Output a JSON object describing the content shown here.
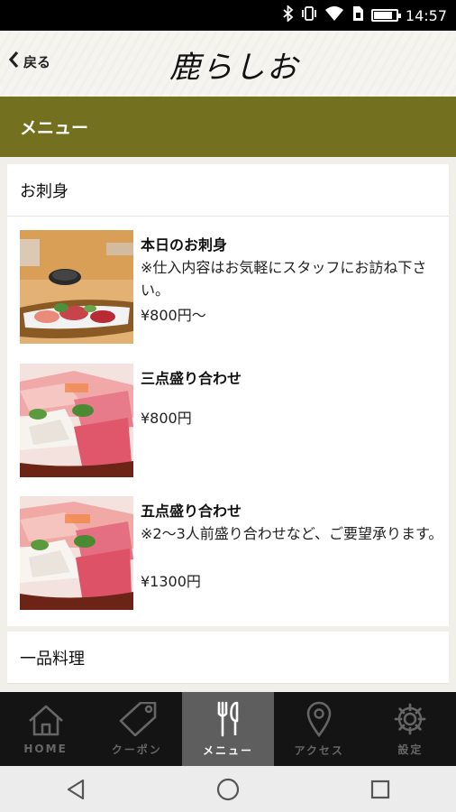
{
  "status_bar": {
    "time": "14:57",
    "icons": [
      "bluetooth-icon",
      "vibrate-icon",
      "wifi-icon",
      "sim-icon",
      "battery-icon"
    ]
  },
  "header": {
    "back_label": "戻る",
    "logo_text": "鹿らしお"
  },
  "page_title": "メニュー",
  "sections": [
    {
      "title": "お刺身"
    },
    {
      "title": "一品料理"
    }
  ],
  "items": [
    {
      "name": "本日のお刺身",
      "description": "※仕入内容はお気軽にスタッフにお訪ね下さい。",
      "price": "¥800円〜"
    },
    {
      "name": "三点盛り合わせ",
      "description": "",
      "price": "¥800円"
    },
    {
      "name": "五点盛り合わせ",
      "description": "※2〜3人前盛り合わせなど、ご要望承ります。",
      "price": "¥1300円"
    }
  ],
  "tabs": [
    {
      "label": "HOME",
      "icon": "home-icon",
      "active": false
    },
    {
      "label": "クーポン",
      "icon": "tag-icon",
      "active": false
    },
    {
      "label": "メニュー",
      "icon": "utensils-icon",
      "active": true
    },
    {
      "label": "アクセス",
      "icon": "map-pin-icon",
      "active": false
    },
    {
      "label": "設定",
      "icon": "gear-icon",
      "active": false
    }
  ],
  "colors": {
    "title_bar": "#73701f",
    "tab_bar": "#141414",
    "tab_active": "#5e5e5e"
  }
}
